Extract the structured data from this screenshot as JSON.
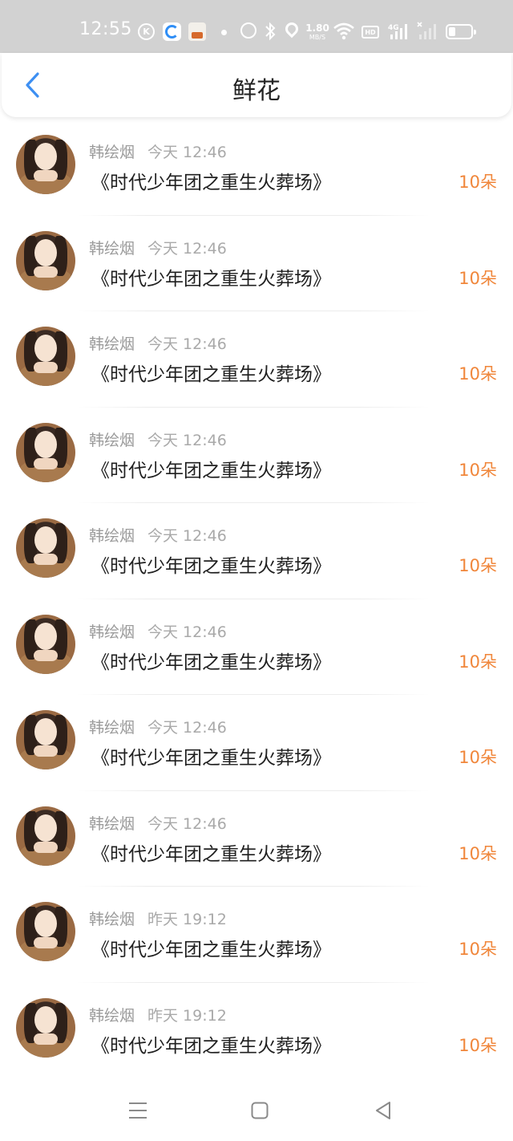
{
  "status_bar": {
    "time": "12:55",
    "net_speed_value": "1.80",
    "net_speed_unit": "MB/S",
    "hd_label": "HD",
    "network_label": "4G",
    "icons": [
      "k-icon",
      "browser-icon",
      "app-icon",
      "dot-icon",
      "alarm-icon",
      "bluetooth-icon",
      "location-icon",
      "wifi-icon",
      "hd-icon",
      "signal-icon",
      "signal-empty-icon",
      "battery-icon"
    ]
  },
  "header": {
    "title": "鲜花",
    "back_icon": "chevron-left-icon",
    "accent_color": "#3d8ff2"
  },
  "records": [
    {
      "user": "韩绘烟",
      "time": "今天 12:46",
      "book": "《时代少年团之重生火葬场》",
      "amount": "10朵"
    },
    {
      "user": "韩绘烟",
      "time": "今天 12:46",
      "book": "《时代少年团之重生火葬场》",
      "amount": "10朵"
    },
    {
      "user": "韩绘烟",
      "time": "今天 12:46",
      "book": "《时代少年团之重生火葬场》",
      "amount": "10朵"
    },
    {
      "user": "韩绘烟",
      "time": "今天 12:46",
      "book": "《时代少年团之重生火葬场》",
      "amount": "10朵"
    },
    {
      "user": "韩绘烟",
      "time": "今天 12:46",
      "book": "《时代少年团之重生火葬场》",
      "amount": "10朵"
    },
    {
      "user": "韩绘烟",
      "time": "今天 12:46",
      "book": "《时代少年团之重生火葬场》",
      "amount": "10朵"
    },
    {
      "user": "韩绘烟",
      "time": "今天 12:46",
      "book": "《时代少年团之重生火葬场》",
      "amount": "10朵"
    },
    {
      "user": "韩绘烟",
      "time": "今天 12:46",
      "book": "《时代少年团之重生火葬场》",
      "amount": "10朵"
    },
    {
      "user": "韩绘烟",
      "time": "昨天 19:12",
      "book": "《时代少年团之重生火葬场》",
      "amount": "10朵"
    },
    {
      "user": "韩绘烟",
      "time": "昨天 19:12",
      "book": "《时代少年团之重生火葬场》",
      "amount": "10朵"
    }
  ],
  "colors": {
    "amount": "#f0863a",
    "meta_text": "#9b9b9b",
    "title_text": "#1f1f1f",
    "status_bar_bg": "#d2d2d2"
  },
  "nav_bar": {
    "icons": [
      "menu-icon",
      "home-square-icon",
      "back-triangle-icon"
    ]
  }
}
